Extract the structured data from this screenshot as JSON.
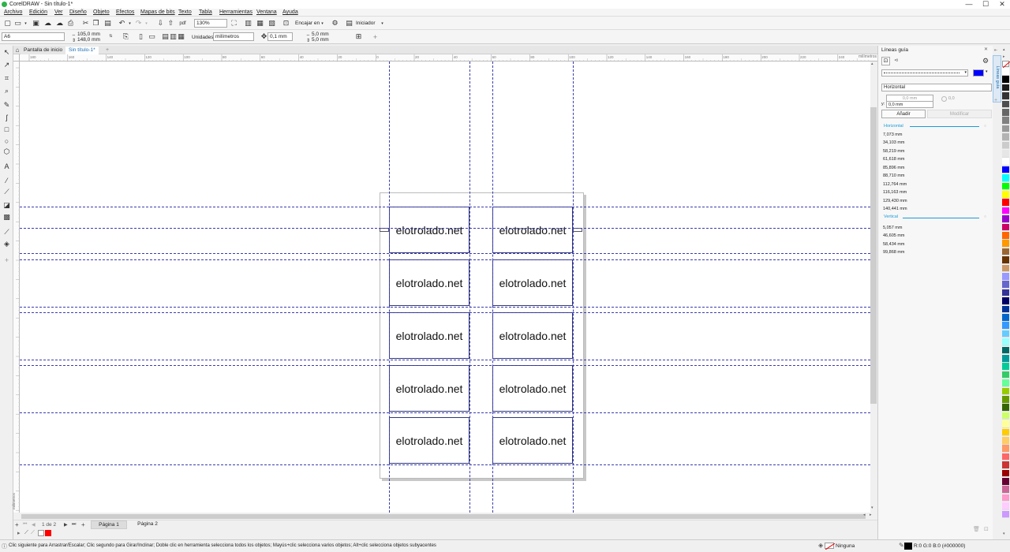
{
  "window": {
    "title": "CorelDRAW - Sin título-1*",
    "minimize": "—",
    "maximize": "☐",
    "close": "✕"
  },
  "menu": [
    "Archivo",
    "Edición",
    "Ver",
    "Diseño",
    "Objeto",
    "Efectos",
    "Mapas de bits",
    "Texto",
    "Tabla",
    "Herramientas",
    "Ventana",
    "Ayuda"
  ],
  "toolbar": {
    "zoom_value": "130%",
    "snap_label": "Encajar en",
    "launcher_label": "Iniciador"
  },
  "property_bar": {
    "page_size": "A6",
    "width": "105,0 mm",
    "height": "148,0 mm",
    "units_label": "Unidades:",
    "units_value": "milímetros",
    "nudge": "0,1 mm",
    "dup_x": "5,0 mm",
    "dup_y": "5,0 mm"
  },
  "doc_tabs": [
    {
      "label": "Pantalla de inicio"
    },
    {
      "label": "Sin título-1*"
    }
  ],
  "ruler": {
    "h_labels": [
      "180",
      "160",
      "140",
      "120",
      "100",
      "80",
      "60",
      "40",
      "20",
      "0",
      "20",
      "40",
      "60",
      "80",
      "100",
      "120",
      "140",
      "160",
      "180",
      "200",
      "220",
      "240"
    ],
    "h_unit": "milímetros",
    "v_unit": "milímetros"
  },
  "canvas": {
    "card_text": "elotrolado.net",
    "card_count": 10
  },
  "page_nav": {
    "page_count": "1 de 2",
    "tabs": [
      "Página 1",
      "Página 2"
    ]
  },
  "status": {
    "hint": "Clic siguiente para Arrastrar/Escalar; Clic segundo para Girar/Inclinar; Doble clic en herramienta selecciona todos los objetos; Mayús+clic selecciona varios objetos; Alt+clic selecciona objetos subyacentes",
    "outline": "Ninguna",
    "fill": "R:0 G:0 B:0 (#000000)"
  },
  "docker": {
    "title": "Líneas guía",
    "orientation": "Horizontal",
    "x_value": "0,0 mm",
    "y_label": "y:",
    "y_value": "0,0 mm",
    "angle_value": "0,0",
    "add_button": "Añadir",
    "modify_button": "Modificar",
    "horizontal_header": "Horizontal",
    "horizontal_guides": [
      "7,073 mm",
      "34,103 mm",
      "58,219 mm",
      "61,618 mm",
      "85,896 mm",
      "88,710 mm",
      "112,764 mm",
      "116,163 mm",
      "129,430 mm",
      "140,441 mm"
    ],
    "vertical_header": "Vertical",
    "vertical_guides": [
      "5,057 mm",
      "46,605 mm",
      "58,434 mm",
      "99,868 mm"
    ],
    "side_tab": "Líneas guía",
    "guide_color": "#0000ff"
  },
  "colors": {
    "accent": "#1a9bd7",
    "guide": "#3b3bb0",
    "card_border": "#333a7a"
  },
  "palette": [
    "#ffffff",
    "#000000",
    "#1a1a1a",
    "#333333",
    "#4d4d4d",
    "#666666",
    "#808080",
    "#999999",
    "#b3b3b3",
    "#cccccc",
    "#e6e6e6",
    "#ffffff",
    "#0000ff",
    "#00ffff",
    "#00ff00",
    "#ffff00",
    "#ff0000",
    "#ff00ff",
    "#9900cc",
    "#cc0066",
    "#ff6600",
    "#ff9900",
    "#996633",
    "#663300",
    "#cc9966",
    "#9999ff",
    "#6666cc",
    "#333399",
    "#000066",
    "#003399",
    "#0066cc",
    "#3399ff",
    "#66ccff",
    "#99ffff",
    "#006666",
    "#009999",
    "#00cc99",
    "#33cc66",
    "#66ff99",
    "#99cc00",
    "#669900",
    "#336600",
    "#ccff66",
    "#ffff99",
    "#ffcc00",
    "#ffcc66",
    "#ff9966",
    "#ff6666",
    "#cc3333",
    "#990000",
    "#660033",
    "#cc6699",
    "#ff99cc",
    "#ffccff",
    "#cc99ff"
  ]
}
